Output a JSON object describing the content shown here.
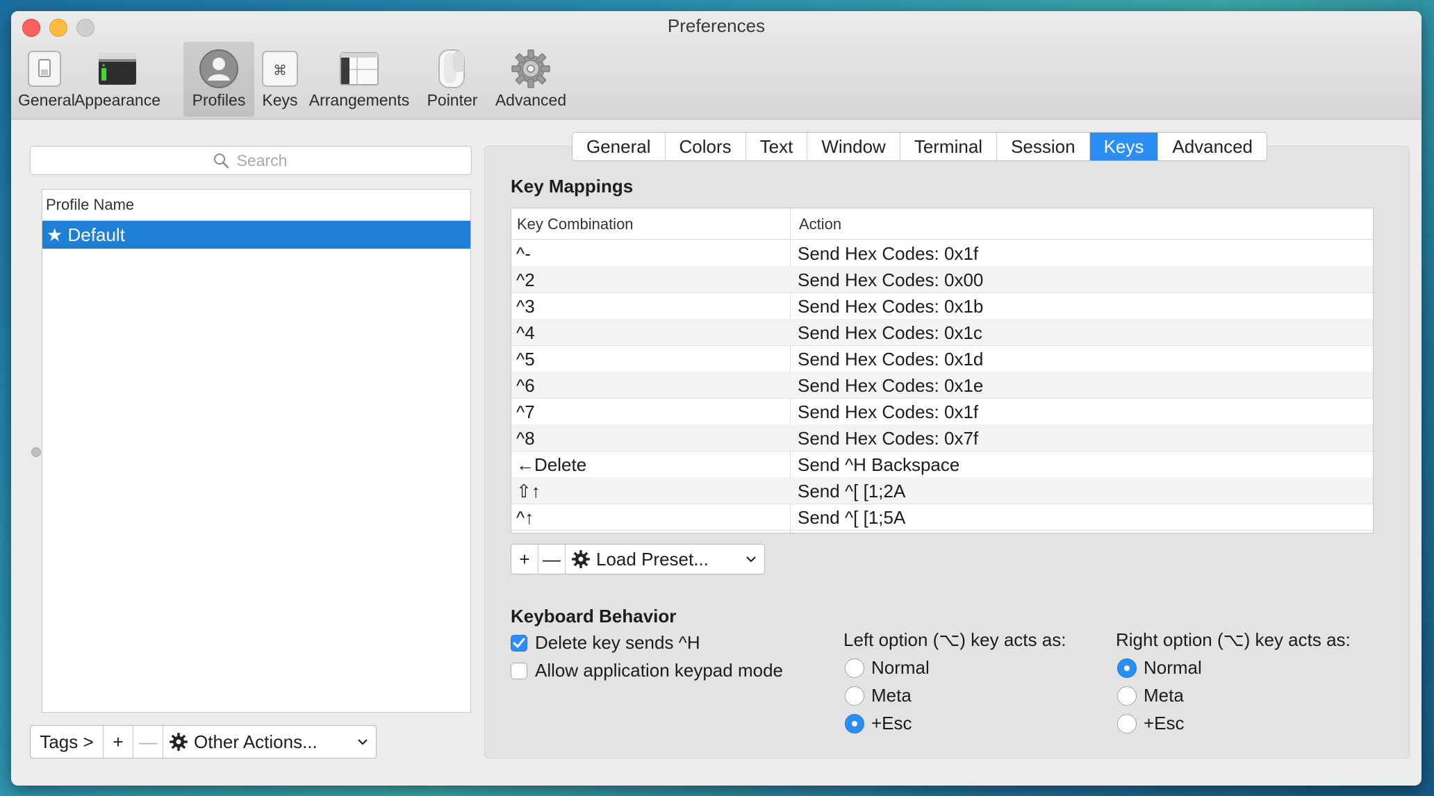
{
  "window": {
    "title": "Preferences"
  },
  "toolbar": {
    "items": [
      {
        "label": "General",
        "icon": "switch-icon"
      },
      {
        "label": "Appearance",
        "icon": "terminal-window-icon"
      },
      {
        "label": "Profiles",
        "icon": "user-silhouette-icon"
      },
      {
        "label": "Keys",
        "icon": "command-key-icon"
      },
      {
        "label": "Arrangements",
        "icon": "window-arrangement-icon"
      },
      {
        "label": "Pointer",
        "icon": "mouse-icon"
      },
      {
        "label": "Advanced",
        "icon": "gear-icon"
      }
    ],
    "selected": "Profiles"
  },
  "profiles": {
    "search_placeholder": "Search",
    "column_header": "Profile Name",
    "items": [
      {
        "name": "★ Default",
        "selected": true
      }
    ],
    "tags_label": "Tags >",
    "add_label": "+",
    "remove_label": "—",
    "other_actions_label": "Other Actions..."
  },
  "tabs": {
    "items": [
      "General",
      "Colors",
      "Text",
      "Window",
      "Terminal",
      "Session",
      "Keys",
      "Advanced"
    ],
    "selected": "Keys"
  },
  "key_mappings": {
    "title": "Key Mappings",
    "col_key": "Key Combination",
    "col_action": "Action",
    "rows": [
      {
        "key": "^-",
        "action": "Send Hex Codes: 0x1f"
      },
      {
        "key": "^2",
        "action": "Send Hex Codes: 0x00"
      },
      {
        "key": "^3",
        "action": "Send Hex Codes: 0x1b"
      },
      {
        "key": "^4",
        "action": "Send Hex Codes: 0x1c"
      },
      {
        "key": "^5",
        "action": "Send Hex Codes: 0x1d"
      },
      {
        "key": "^6",
        "action": "Send Hex Codes: 0x1e"
      },
      {
        "key": "^7",
        "action": "Send Hex Codes: 0x1f"
      },
      {
        "key": "^8",
        "action": "Send Hex Codes: 0x7f"
      },
      {
        "key": "←Delete",
        "action": "Send ^H Backspace"
      },
      {
        "key": "⇧↑",
        "action": "Send ^[ [1;2A"
      },
      {
        "key": "^↑",
        "action": "Send ^[ [1;5A"
      }
    ],
    "add_label": "+",
    "remove_label": "—",
    "load_preset_label": "Load Preset..."
  },
  "keyboard_behavior": {
    "title": "Keyboard Behavior",
    "delete_sends_h": {
      "label": "Delete key sends ^H",
      "checked": true
    },
    "app_keypad": {
      "label": "Allow application keypad mode",
      "checked": false
    },
    "left_option": {
      "title": "Left option (⌥) key acts as:",
      "options": [
        "Normal",
        "Meta",
        "+Esc"
      ],
      "selected": "+Esc"
    },
    "right_option": {
      "title": "Right option (⌥) key acts as:",
      "options": [
        "Normal",
        "Meta",
        "+Esc"
      ],
      "selected": "Normal"
    }
  },
  "colors": {
    "accent": "#2a8ef4",
    "selection": "#1e7fd6",
    "close": "#fc615d",
    "minimize": "#fdbc40",
    "zoom": "#cfcfcf"
  }
}
